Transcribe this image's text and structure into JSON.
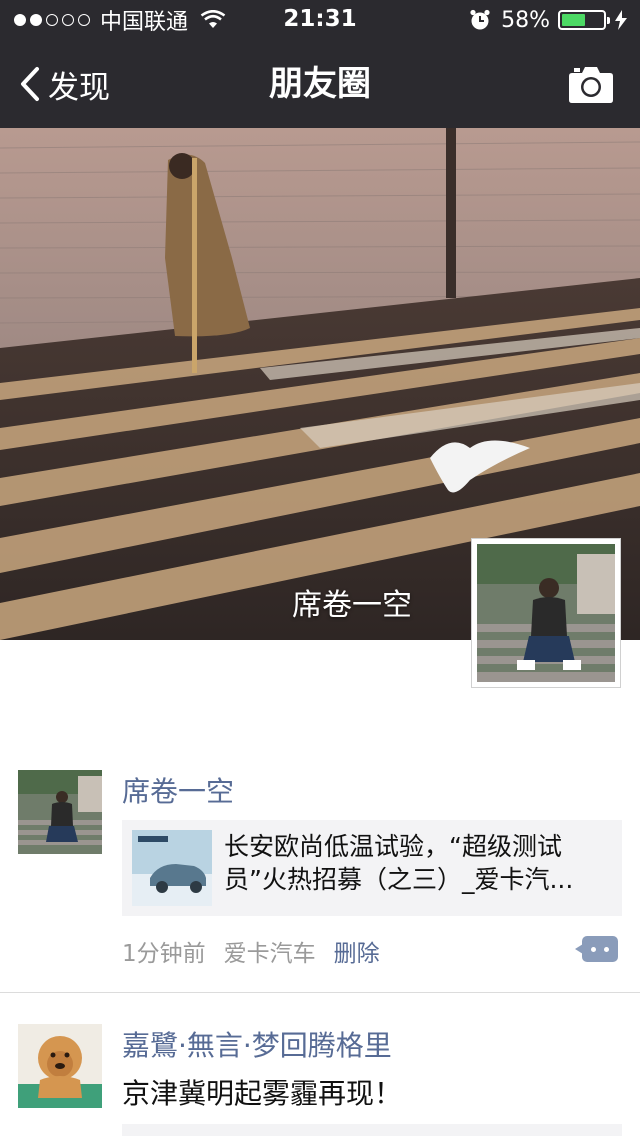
{
  "status_bar": {
    "carrier": "中国联通",
    "time": "21:31",
    "battery": "58%",
    "battery_level": 0.58,
    "signal_strength": 2,
    "signal_total": 5
  },
  "nav": {
    "back_label": "发现",
    "title": "朋友圈",
    "right_icon": "camera-icon"
  },
  "cover": {
    "user_name": "席卷一空"
  },
  "posts": [
    {
      "user": "席卷一空",
      "link_title": "长安欧尚低温试验，“超级测试员”火热招募（之三）_爱卡汽...",
      "time": "1分钟前",
      "source": "爱卡汽车",
      "delete_label": "删除"
    },
    {
      "user": "嘉鷺·無言·梦回腾格里",
      "text": "京津冀明起雾霾再现！"
    }
  ],
  "colors": {
    "nav_bg": "#2b2a2f",
    "name_link": "#576b95",
    "card_bg": "#f3f3f5",
    "battery_green": "#4cd964"
  }
}
